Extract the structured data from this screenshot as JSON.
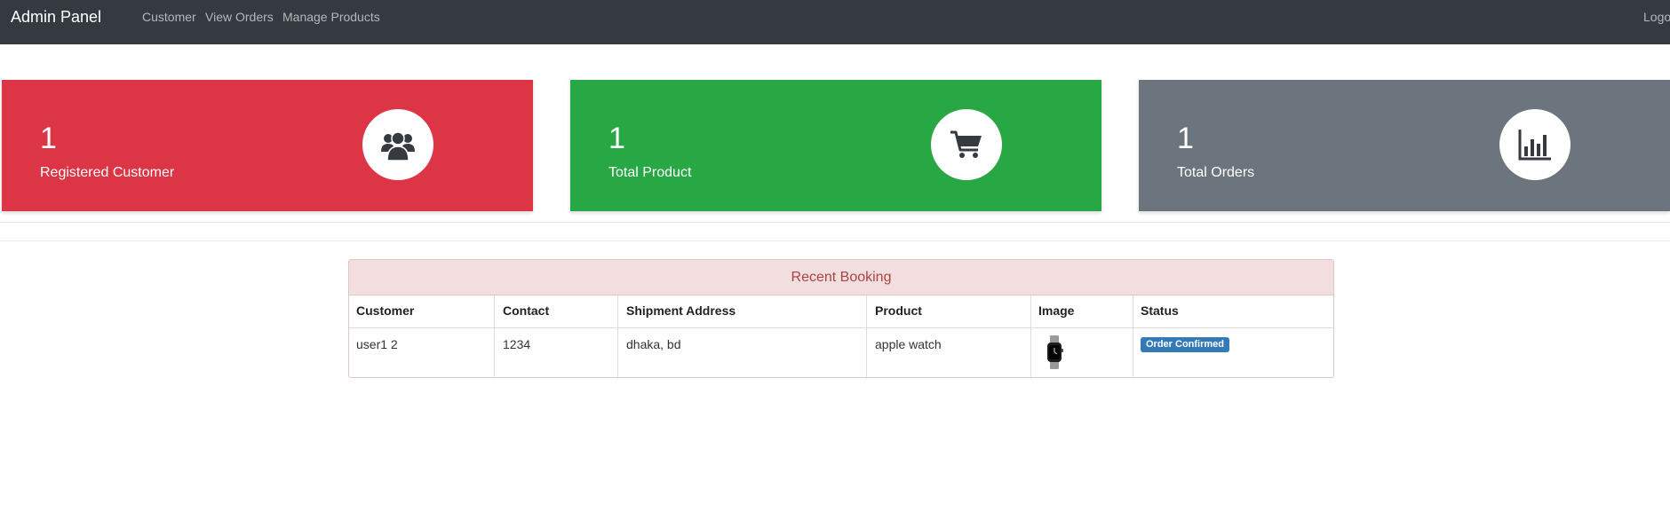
{
  "navbar": {
    "brand": "Admin Panel",
    "links": [
      "Customer",
      "View Orders",
      "Manage Products"
    ],
    "logout": "Logout",
    "background": "#343a40"
  },
  "stats": [
    {
      "value": "1",
      "label": "Registered Customer",
      "color": "#dc3545",
      "icon": "users-icon"
    },
    {
      "value": "1",
      "label": "Total Product",
      "color": "#28a745",
      "icon": "cart-icon"
    },
    {
      "value": "1",
      "label": "Total Orders",
      "color": "#6c757d",
      "icon": "bar-chart-icon"
    }
  ],
  "booking": {
    "title": "Recent Booking",
    "columns": [
      "Customer",
      "Contact",
      "Shipment Address",
      "Product",
      "Image",
      "Status"
    ],
    "rows": [
      {
        "customer": "user1 2",
        "contact": "1234",
        "address": "dhaka, bd",
        "product": "apple watch",
        "image": "apple-watch-thumbnail",
        "status": "Order Confirmed",
        "status_color": "#337ab7"
      }
    ],
    "heading_bg": "#f2dede",
    "heading_color": "#a94442"
  }
}
